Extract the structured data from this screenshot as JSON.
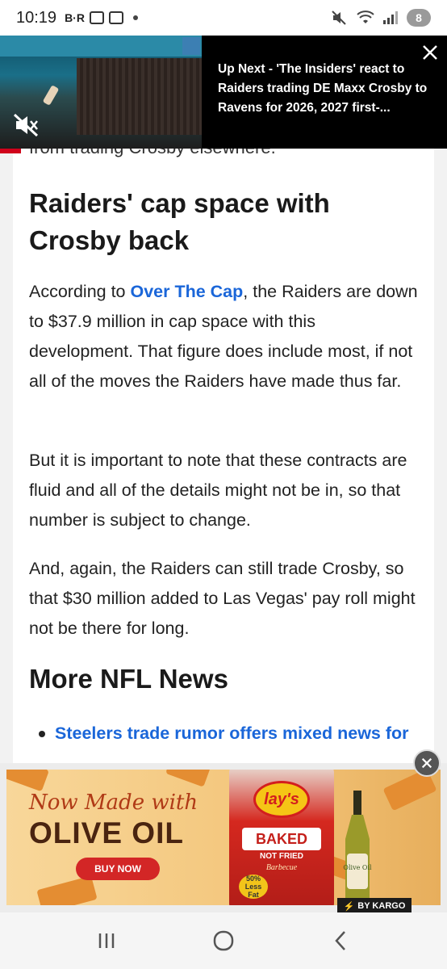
{
  "status_bar": {
    "time": "10:19",
    "br_label": "B·R",
    "notification_count": "8"
  },
  "video": {
    "title": "Up Next - 'The Insiders' react to Raiders trading DE Maxx Crosby to Ravens for 2026, 2027 first-..."
  },
  "article": {
    "cut_text": "from trading Crosby elsewhere.",
    "heading_1": "Raiders' cap space with Crosby back",
    "para_1_prefix": "According to ",
    "para_1_link": "Over The Cap",
    "para_1_suffix": ", the Raiders are down to $37.9 million in cap space with this development. That figure does include most, if not all of the moves the Raiders have made thus far.",
    "para_2": "But it is important to note that these contracts are fluid and all of the details might not be in, so that number is subject to change.",
    "para_3": "And, again, the Raiders can still trade Crosby, so that $30 million added to Las Vegas' pay roll might not be there for long.",
    "heading_2": "More NFL News",
    "news_items": [
      {
        "label": "Steelers trade rumor offers mixed news for"
      }
    ]
  },
  "ad": {
    "headline_1": "Now Made with",
    "headline_2": "OLIVE OIL",
    "buy_label": "BUY NOW",
    "brand": "lay's",
    "bag_label": "BAKED",
    "bag_sub": "NOT FRIED",
    "bag_flavor": "Barbecue",
    "bag_badge": "50% Less Fat",
    "bottle_text": "Olive Oil",
    "sponsor_label": "BY KARGO"
  },
  "colors": {
    "link": "#1a66d9",
    "accent_red": "#d0021b"
  }
}
